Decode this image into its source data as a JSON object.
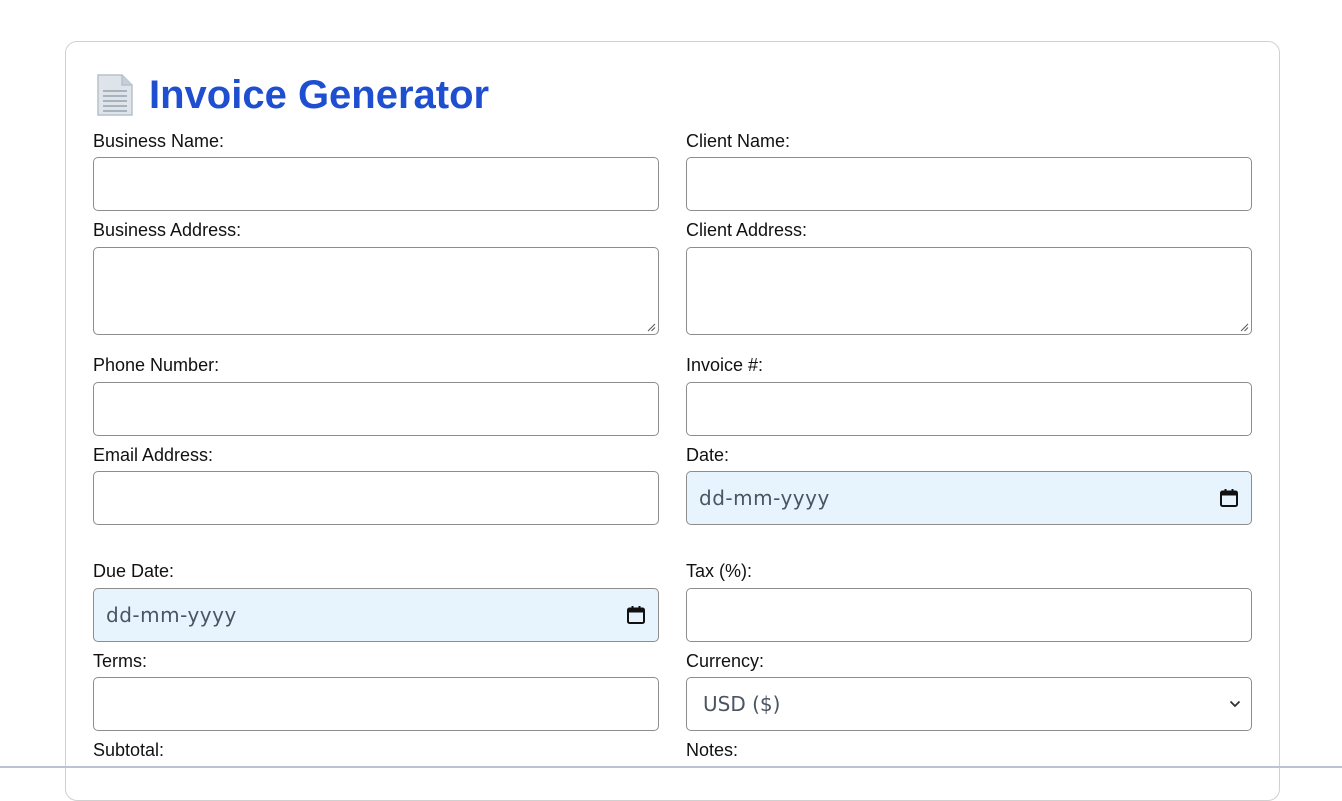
{
  "header": {
    "title": "Invoice Generator",
    "icon": "document-icon"
  },
  "form": {
    "business_name": {
      "label": "Business Name:",
      "value": ""
    },
    "client_name": {
      "label": "Client Name:",
      "value": ""
    },
    "business_address": {
      "label": "Business Address:",
      "value": ""
    },
    "client_address": {
      "label": "Client Address:",
      "value": ""
    },
    "phone_number": {
      "label": "Phone Number:",
      "value": ""
    },
    "invoice_number": {
      "label": "Invoice #:",
      "value": ""
    },
    "email_address": {
      "label": "Email Address:",
      "value": ""
    },
    "date": {
      "label": "Date:",
      "placeholder": "dd-mm-yyyy"
    },
    "due_date": {
      "label": "Due Date:",
      "placeholder": "dd-mm-yyyy"
    },
    "tax": {
      "label": "Tax (%):",
      "value": ""
    },
    "terms": {
      "label": "Terms:",
      "value": ""
    },
    "currency": {
      "label": "Currency:",
      "selected": "USD ($)"
    },
    "subtotal": {
      "label": "Subtotal:"
    },
    "notes": {
      "label": "Notes:"
    }
  },
  "colors": {
    "title": "#1f4fd1",
    "date_field_bg": "#e8f4fd",
    "border": "#8d8d8d"
  }
}
